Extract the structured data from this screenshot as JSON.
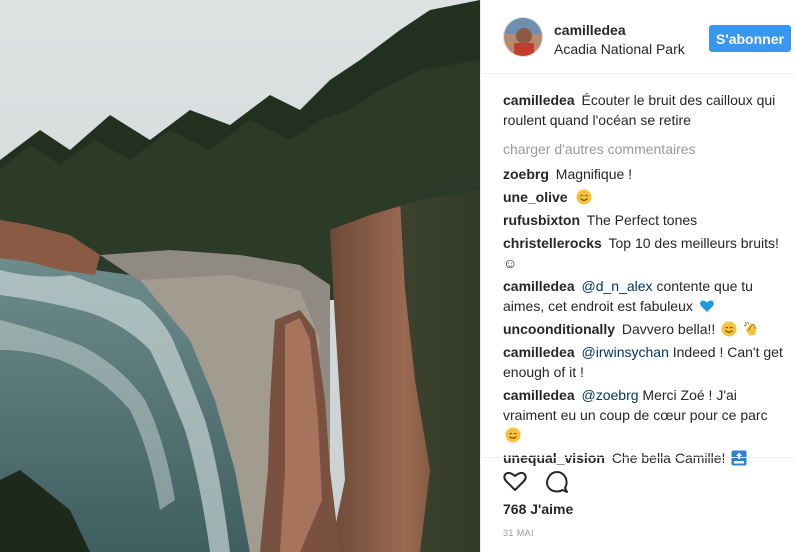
{
  "post": {
    "author": "camilledea",
    "location": "Acadia National Park",
    "follow_label": "S'abonner",
    "caption": "Écouter le bruit des cailloux qui roulent quand l'océan se retire",
    "load_more_label": "charger d'autres commentaires",
    "likes_label": "768 J'aime",
    "date_label": "31 MAI"
  },
  "comments": [
    {
      "user": "zoebrg",
      "text": "Magnifique !"
    },
    {
      "user": "une_olive",
      "text": "",
      "emoji": "smiling-face-icon"
    },
    {
      "user": "rufusbixton",
      "text": "The Perfect tones"
    },
    {
      "user": "christellerocks",
      "text": "Top 10 des meilleurs bruits! ☺"
    },
    {
      "user": "camilledea",
      "mention": "@d_n_alex",
      "text": "contente que tu aimes, cet endroit est fabuleux",
      "emoji": "blue-heart-icon"
    },
    {
      "user": "uncoonditionally",
      "text": "Davvero bella!!",
      "emoji": "smiling-face-icon",
      "emoji2": "clapping-hands-icon"
    },
    {
      "user": "camilledea",
      "mention": "@irwinsychan",
      "text": "Indeed ! Can't get enough of it !"
    },
    {
      "user": "camilledea",
      "mention": "@zoebrg",
      "text": "Merci Zoé ! J'ai vraiment eu un coup de cœur pour ce parc",
      "emoji": "smiling-face-icon"
    },
    {
      "user": "unequal_vision",
      "text": "Che bella Camille!",
      "emoji": "top-arrow-icon"
    }
  ],
  "colors": {
    "accent": "#3897f0",
    "mention": "#003569",
    "muted": "#999999"
  }
}
